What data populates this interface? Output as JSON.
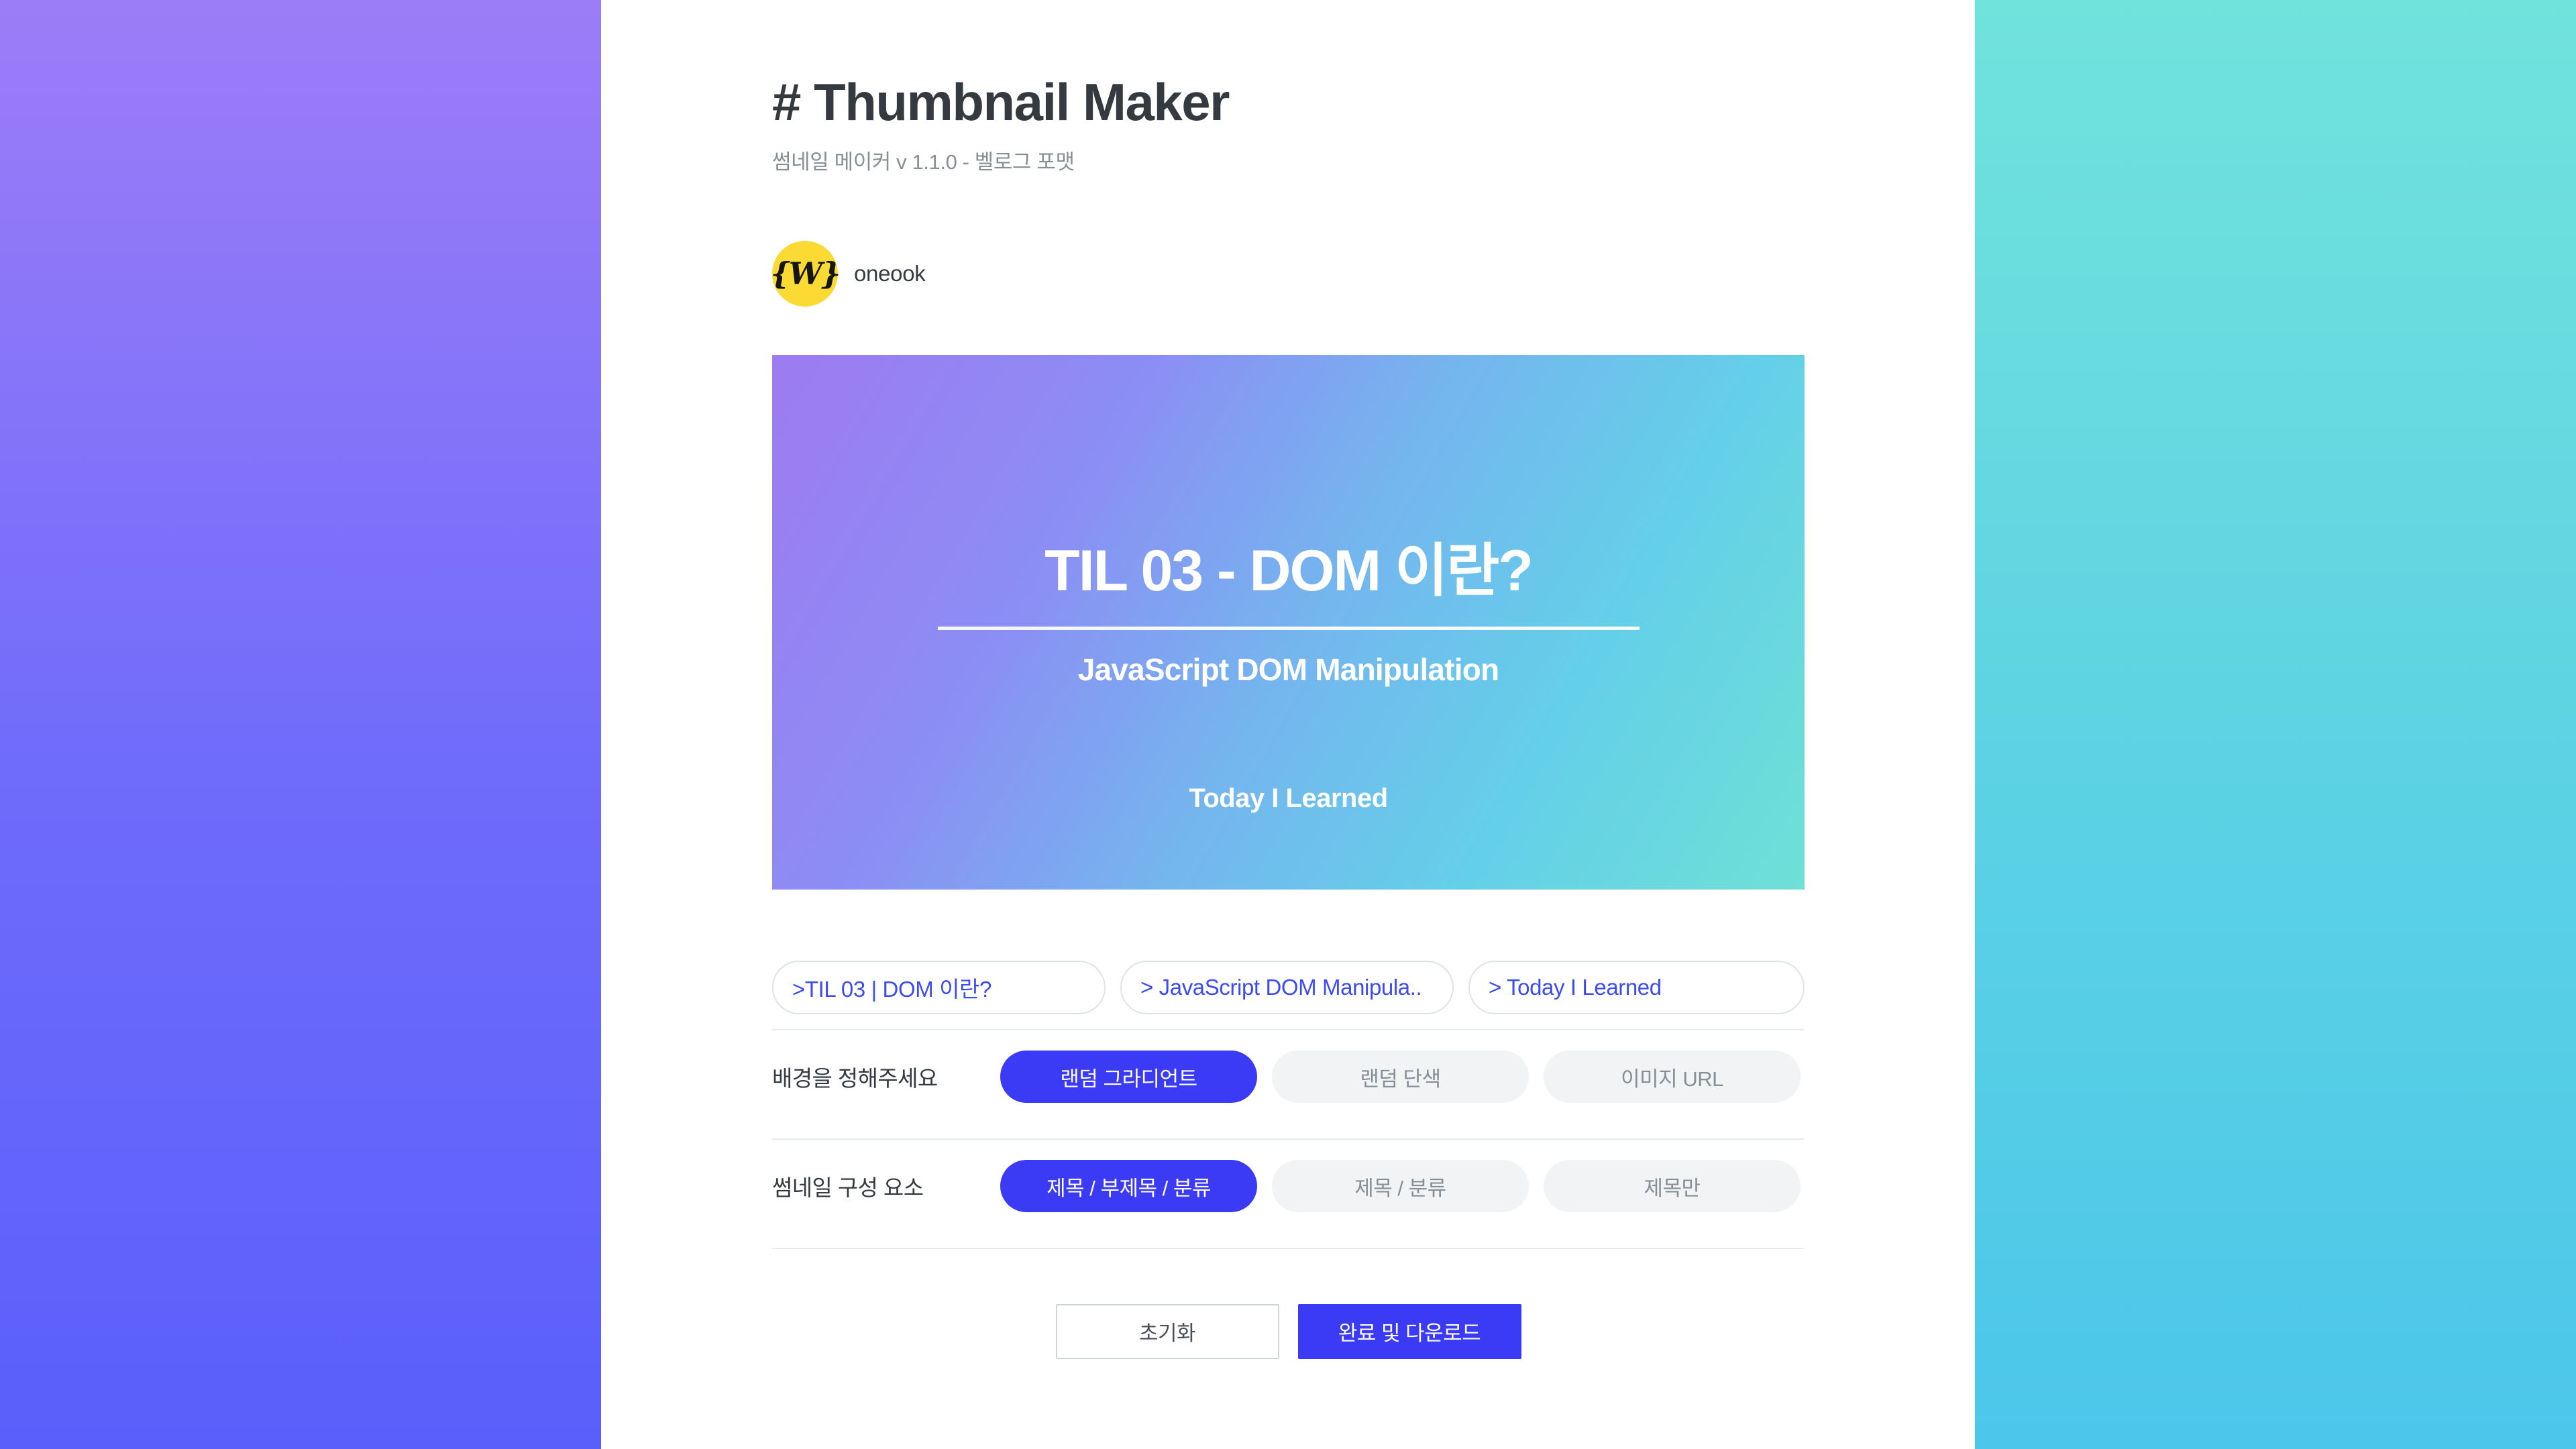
{
  "header": {
    "title": "# Thumbnail Maker",
    "subtitle": "썸네일 메이커 v 1.1.0 - 벨로그 포맷"
  },
  "author": {
    "avatar_glyph": "{W}",
    "avatar_icon": "velog-logo-icon",
    "avatar_color": "#fada33",
    "name": "oneook"
  },
  "preview": {
    "title": "TIL 03 - DOM 이란?",
    "subtitle": "JavaScript DOM Manipulation",
    "category": "Today I Learned",
    "gradient_from": "#9d7bf1",
    "gradient_to": "#6fe0d6"
  },
  "inputs": [
    {
      "name": "title-input",
      "value": ">TIL 03 | DOM 이란?",
      "placeholder": "제목을 입력하세요"
    },
    {
      "name": "subtitle-input",
      "value": "> JavaScript DOM Manipula..",
      "placeholder": "부제목을 입력하세요"
    },
    {
      "name": "category-input",
      "value": "> Today I Learned",
      "placeholder": "분류를 입력하세요"
    }
  ],
  "options": [
    {
      "label": "배경을 정해주세요",
      "buttons": [
        {
          "label": "랜덤 그라디언트",
          "active": true
        },
        {
          "label": "랜덤 단색",
          "active": false
        },
        {
          "label": "이미지 URL",
          "active": false
        }
      ]
    },
    {
      "label": "썸네일 구성 요소",
      "buttons": [
        {
          "label": "제목 / 부제목 / 분류",
          "active": true
        },
        {
          "label": "제목 / 분류",
          "active": false
        },
        {
          "label": "제목만",
          "active": false
        }
      ]
    }
  ],
  "actions": {
    "reset_label": "초기화",
    "download_label": "완료 및 다운로드",
    "accent_color": "#3b3bf5"
  },
  "background": {
    "left_gradient_from": "#9c7df7",
    "left_gradient_to": "#5a5ffb",
    "right_gradient_from": "#71e2dc",
    "right_gradient_to": "#4cc6ea"
  }
}
